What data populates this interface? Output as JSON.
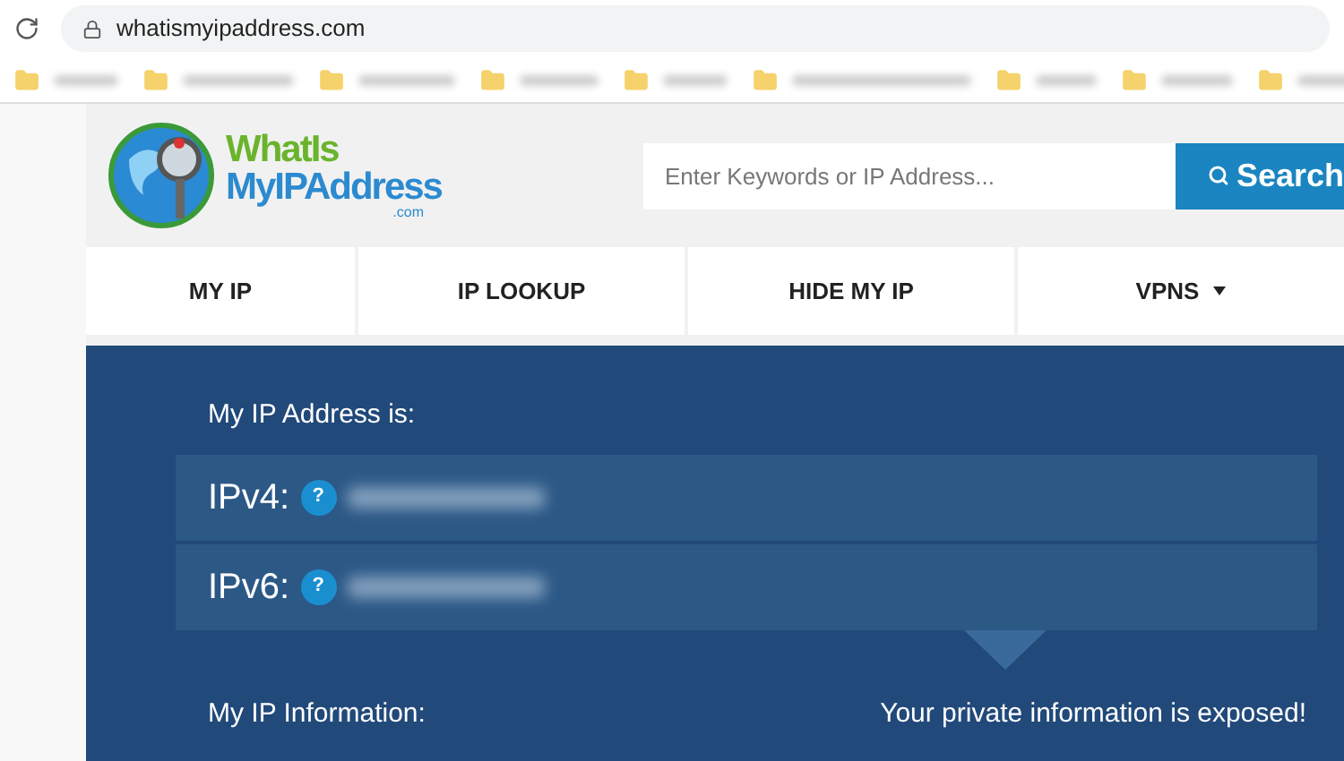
{
  "browser": {
    "url": "whatismyipaddress.com"
  },
  "bookmarks": [
    {
      "kind": "folder"
    },
    {
      "kind": "folder"
    },
    {
      "kind": "folder"
    },
    {
      "kind": "folder"
    },
    {
      "kind": "folder"
    },
    {
      "kind": "folder"
    },
    {
      "kind": "folder"
    },
    {
      "kind": "folder"
    },
    {
      "kind": "folder"
    }
  ],
  "logo": {
    "line_1": "WhatIs",
    "line_2": "MyIPAddress",
    "suffix": ".com"
  },
  "search": {
    "placeholder": "Enter Keywords or IP Address...",
    "button": "Search"
  },
  "nav": [
    {
      "label": "MY IP",
      "dropdown": false
    },
    {
      "label": "IP LOOKUP",
      "dropdown": false
    },
    {
      "label": "HIDE MY IP",
      "dropdown": false
    },
    {
      "label": "VPNS",
      "dropdown": true
    }
  ],
  "panel": {
    "heading": "My IP Address is:",
    "rows": [
      {
        "label": "IPv4:",
        "help": "?"
      },
      {
        "label": "IPv6:",
        "help": "?"
      }
    ],
    "info_heading": "My IP Information:",
    "warning": "Your private information is exposed!"
  }
}
